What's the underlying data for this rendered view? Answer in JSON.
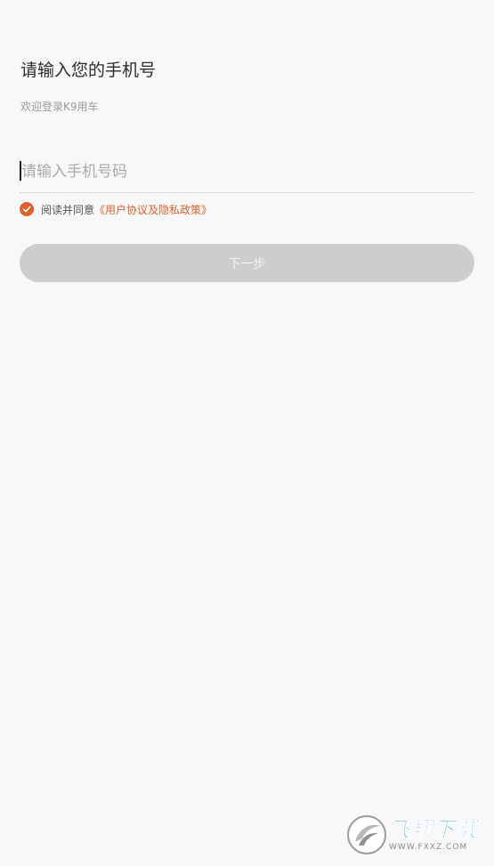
{
  "login": {
    "title": "请输入您的手机号",
    "subtitle": "欢迎登录K9用车",
    "phone_placeholder": "请输入手机号码",
    "phone_value": "",
    "agree_prefix": "阅读并同意",
    "policy_link": "《用户协议及隐私政策》",
    "agree_checked": true,
    "next_label": "下一步"
  },
  "watermark": {
    "name": "飞翔下载",
    "url": "WWW.FXXZ.COM"
  },
  "colors": {
    "background": "#f8f8f8",
    "accent": "#e0602c",
    "button_disabled": "#cdcdcd",
    "watermark_blue": "#2f9be0"
  },
  "icons": {
    "agree_check": "checkmark-circle-icon",
    "watermark_logo": "fxxz-logo-icon"
  }
}
